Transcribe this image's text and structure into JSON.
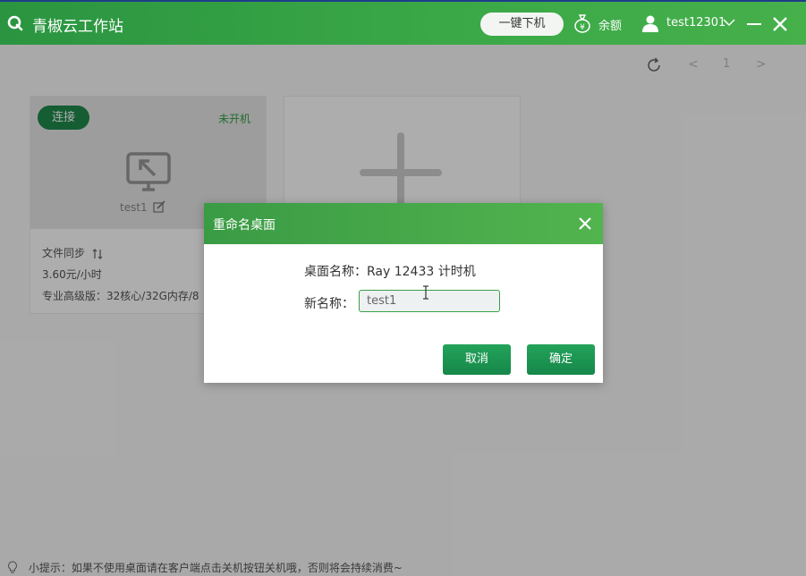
{
  "app": {
    "title": "青椒云工作站"
  },
  "header": {
    "one_click_shutdown": "一键下机",
    "balance_label": "余额",
    "username": "test12301"
  },
  "toolbar": {
    "page_prev": "<",
    "page_number": "1",
    "page_next": ">"
  },
  "desktop_card": {
    "connect_label": "连接",
    "status": "未开机",
    "name": "test1",
    "file_sync": "文件同步",
    "price": "3.60元/小时",
    "spec": "专业高级版：32核心/32G内存/8"
  },
  "tip": {
    "text": "小提示：如果不使用桌面请在客户端点击关机按钮关机哦，否则将会持续消费~"
  },
  "dialog": {
    "title": "重命名桌面",
    "current_name_label": "桌面名称：",
    "current_name_value": "Ray 12433 计时机",
    "new_name_label": "新名称：",
    "new_name_value": "test1",
    "cancel_label": "取消",
    "confirm_label": "确定"
  },
  "colors": {
    "brand_green": "#3aa847",
    "button_green": "#1f8a4c",
    "status_green": "#35a047"
  }
}
